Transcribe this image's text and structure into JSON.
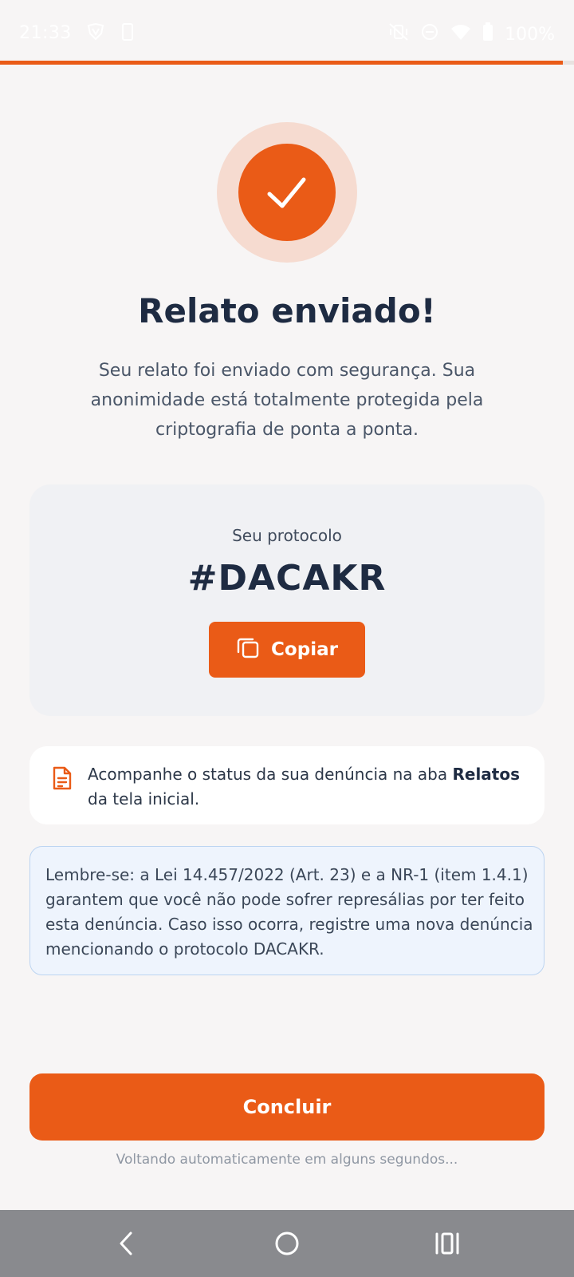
{
  "status_bar": {
    "time": "21:33",
    "battery": "100%",
    "icons": [
      "vpn-shield-icon",
      "phone-icon",
      "vibrate-off-icon",
      "do-not-disturb-icon",
      "wifi-icon",
      "battery-icon"
    ]
  },
  "progress": {
    "fraction": 0.98
  },
  "colors": {
    "accent": "#ea5b17",
    "halo": "#f6dbd0",
    "title": "#1e2b42",
    "legal_bg": "#eef4fd",
    "legal_border": "#bcd4f1"
  },
  "success": {
    "icon": "check-icon",
    "title": "Relato enviado!",
    "message": "Seu relato foi enviado com segurança. Sua anonimidade está totalmente protegida pela criptografia de ponta a ponta."
  },
  "protocol": {
    "label": "Seu protocolo",
    "code": "#DACAKR",
    "copy_label": "Copiar",
    "copy_icon": "copy-icon"
  },
  "info": {
    "icon": "document-icon",
    "text_before": "Acompanhe o status da sua denúncia na aba ",
    "text_bold": "Relatos",
    "text_after": " da tela inicial."
  },
  "legal": {
    "text": "Lembre-se: a Lei 14.457/2022 (Art. 23) e a NR-1 (item 1.4.1) garantem que você não pode sofrer represálias por ter feito esta denúncia. Caso isso ocorra, registre uma nova denúncia mencionando o protocolo DACAKR."
  },
  "actions": {
    "conclude_label": "Concluir",
    "auto_return": "Voltando automaticamente em alguns segundos..."
  },
  "nav_bar": {
    "icons": [
      "back-icon",
      "home-icon",
      "recents-icon"
    ]
  }
}
